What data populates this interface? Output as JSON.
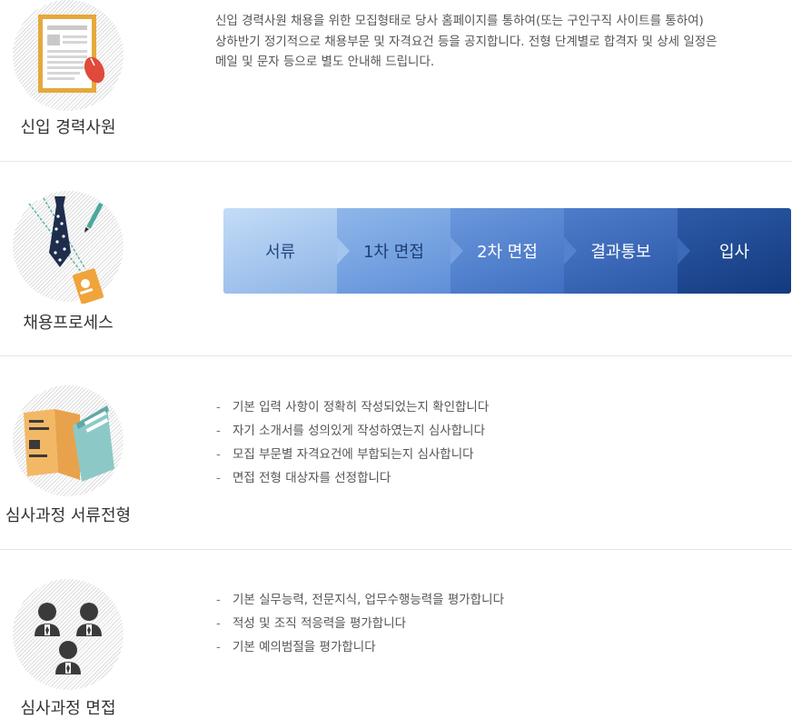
{
  "sections": [
    {
      "label": "신입 경력사원",
      "icon": "document-mouse-icon",
      "description": [
        "신입 경력사원 채용을 위한 모집형태로 당사 홈페이지를 통하여(또는 구인구직 사이트를 통하여)",
        "상하반기 정기적으로 채용부문 및 자격요건 등을 공지합니다. 전형 단계별로 합격자 및 상세 일정은",
        "메일 및 문자 등으로 별도 안내해 드립니다."
      ]
    },
    {
      "label": "채용프로세스",
      "icon": "tie-badge-icon",
      "steps": [
        "서류",
        "1차 면접",
        "2차 면접",
        "결과통보",
        "입사"
      ]
    },
    {
      "label": "심사과정  서류전형",
      "icon": "books-icon",
      "bullets": [
        "기본 입력 사항이 정확히 작성되었는지 확인합니다",
        "자기 소개서를 성의있게 작성하였는지 심사합니다",
        "모집 부문별 자격요건에 부합되는지 심사합니다",
        "면접 전형 대상자를 선정합니다"
      ]
    },
    {
      "label": "심사과정  면접",
      "icon": "people-icon",
      "bullets": [
        "기본 실무능력, 전문지식, 업무수행능력을 평가합니다",
        "적성 및 조직 적응력을 평가합니다",
        "기본 예의범절을 평가합니다"
      ]
    }
  ],
  "bullet_marker": "-",
  "colors": {
    "step_colors": [
      "#a9caf0",
      "#7aa6e2",
      "#4e7fcf",
      "#3262b2",
      "#1d4a92"
    ],
    "step_text": [
      "#2a4f8e",
      "#1f427c",
      "#ffffff",
      "#ffffff",
      "#ffffff"
    ]
  }
}
